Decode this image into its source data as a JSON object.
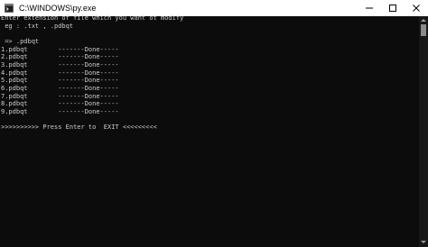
{
  "window": {
    "title": "C:\\WINDOWS\\py.exe",
    "app_icon": "console-app-icon",
    "controls": [
      "minimize-icon",
      "maximize-icon",
      "close-icon"
    ]
  },
  "colors": {
    "console_background": "#0c0c0c",
    "console_text": "#cccccc",
    "titlebar_background": "#ffffff",
    "scrollbar_track": "#171717",
    "scrollbar_thumb": "#8a8a8a"
  },
  "console": {
    "text": "Enter extension of file which you want ot modify\n eg : .txt , .pdbqt\n\n => .pdbqt\n1.pdbqt        -------Done-----\n2.pdbqt        -------Done-----\n3.pdbqt        -------Done-----\n4.pdbqt        -------Done-----\n5.pdbqt        -------Done-----\n6.pdbqt        -------Done-----\n7.pdbqt        -------Done-----\n8.pdbqt        -------Done-----\n9.pdbqt        -------Done-----\n\n>>>>>>>>>> Press Enter to  EXIT <<<<<<<<<"
  }
}
